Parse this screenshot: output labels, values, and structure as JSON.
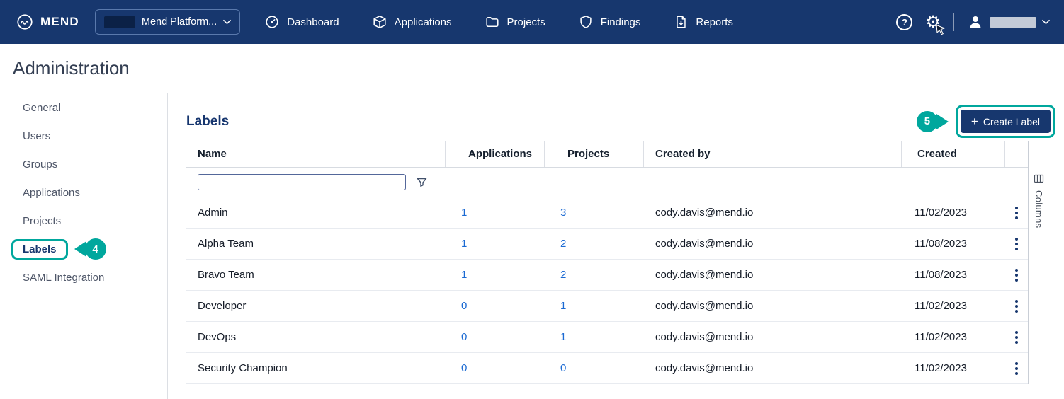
{
  "colors": {
    "brand_navy": "#17376E",
    "annotation_teal": "#00A79D",
    "link_blue": "#1B6AD3"
  },
  "icons": {
    "help": "?",
    "gear": "⚙",
    "plus": "+"
  },
  "topnav": {
    "brand": "MEND",
    "platform_selector": "Mend Platform...",
    "items": [
      {
        "label": "Dashboard"
      },
      {
        "label": "Applications"
      },
      {
        "label": "Projects"
      },
      {
        "label": "Findings"
      },
      {
        "label": "Reports"
      }
    ]
  },
  "page": {
    "title": "Administration"
  },
  "sidebar": {
    "items": [
      {
        "label": "General"
      },
      {
        "label": "Users"
      },
      {
        "label": "Groups"
      },
      {
        "label": "Applications"
      },
      {
        "label": "Projects"
      },
      {
        "label": "Labels",
        "active": true
      },
      {
        "label": "SAML Integration"
      }
    ]
  },
  "main": {
    "heading": "Labels",
    "create_button_label": "Create Label",
    "columns_toggle_label": "Columns",
    "table": {
      "headers": [
        "Name",
        "Applications",
        "Projects",
        "Created by",
        "Created"
      ],
      "rows": [
        {
          "name": "Admin",
          "applications": "1",
          "projects": "3",
          "created_by": "cody.davis@mend.io",
          "created": "11/02/2023"
        },
        {
          "name": "Alpha Team",
          "applications": "1",
          "projects": "2",
          "created_by": "cody.davis@mend.io",
          "created": "11/08/2023"
        },
        {
          "name": "Bravo Team",
          "applications": "1",
          "projects": "2",
          "created_by": "cody.davis@mend.io",
          "created": "11/08/2023"
        },
        {
          "name": "Developer",
          "applications": "0",
          "projects": "1",
          "created_by": "cody.davis@mend.io",
          "created": "11/02/2023"
        },
        {
          "name": "DevOps",
          "applications": "0",
          "projects": "1",
          "created_by": "cody.davis@mend.io",
          "created": "11/02/2023"
        },
        {
          "name": "Security Champion",
          "applications": "0",
          "projects": "0",
          "created_by": "cody.davis@mend.io",
          "created": "11/02/2023"
        }
      ]
    }
  },
  "annotations": {
    "step4": "4",
    "step5": "5"
  }
}
